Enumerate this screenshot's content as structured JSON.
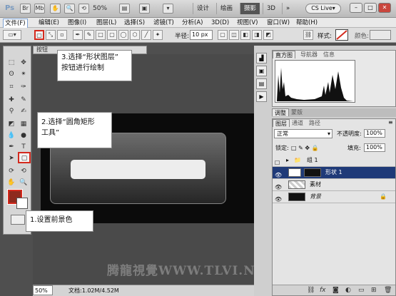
{
  "titlebar": {
    "logo": "Ps",
    "zoom": "50%",
    "workspaces": [
      "设计",
      "绘画",
      "摄影",
      "3D"
    ],
    "more": "»",
    "cs_live": "CS Live▾",
    "window_buttons": [
      "–",
      "□",
      "✕"
    ]
  },
  "menu": [
    "文件(F)",
    "编辑(E)",
    "图像(I)",
    "图层(L)",
    "选择(S)",
    "滤镜(T)",
    "分析(A)",
    "3D(D)",
    "视图(V)",
    "窗口(W)",
    "帮助(H)"
  ],
  "options": {
    "radius_label": "半径:",
    "radius_value": "10 px",
    "style_label": "样式:",
    "color_label": "颜色:"
  },
  "document": {
    "tab_label": "按钮",
    "watermark": "腾龍視覺WWW.TLVI.NET"
  },
  "status": {
    "zoom": "50%",
    "doc_info": "文档:1.02M/4.52M"
  },
  "panels": {
    "top_tabs": [
      "直方图",
      "导航器",
      "信息"
    ],
    "adjust_tabs": [
      "调整",
      "蒙版"
    ],
    "layer_tabs": [
      "图层",
      "通道",
      "路径"
    ],
    "blend_mode": "正常",
    "opacity_label": "不透明度:",
    "opacity_value": "100%",
    "lock_label": "锁定:",
    "fill_label": "填充:",
    "fill_value": "100%",
    "layers": [
      {
        "name": "组 1",
        "type": "group"
      },
      {
        "name": "形状 1",
        "type": "shape",
        "selected": true
      },
      {
        "name": "素材",
        "type": "pixel"
      },
      {
        "name": "背景",
        "type": "background",
        "locked": true
      }
    ],
    "footer_icons": [
      "link-icon",
      "fx-icon",
      "mask-icon",
      "adjustment-icon",
      "folder-icon",
      "new-layer-icon",
      "trash-icon"
    ]
  },
  "callouts": {
    "step1": "1.设置前景色",
    "step2_line1": "2.选择“圆角矩形",
    "step2_line2": "工具”",
    "step3_line1": "3.选择“形状图层”",
    "step3_line2": "按钮进行绘制"
  },
  "colors": {
    "highlight": "#d42a1e",
    "foreground": "#8e2a1e",
    "selected_layer": "#1f3a78"
  }
}
